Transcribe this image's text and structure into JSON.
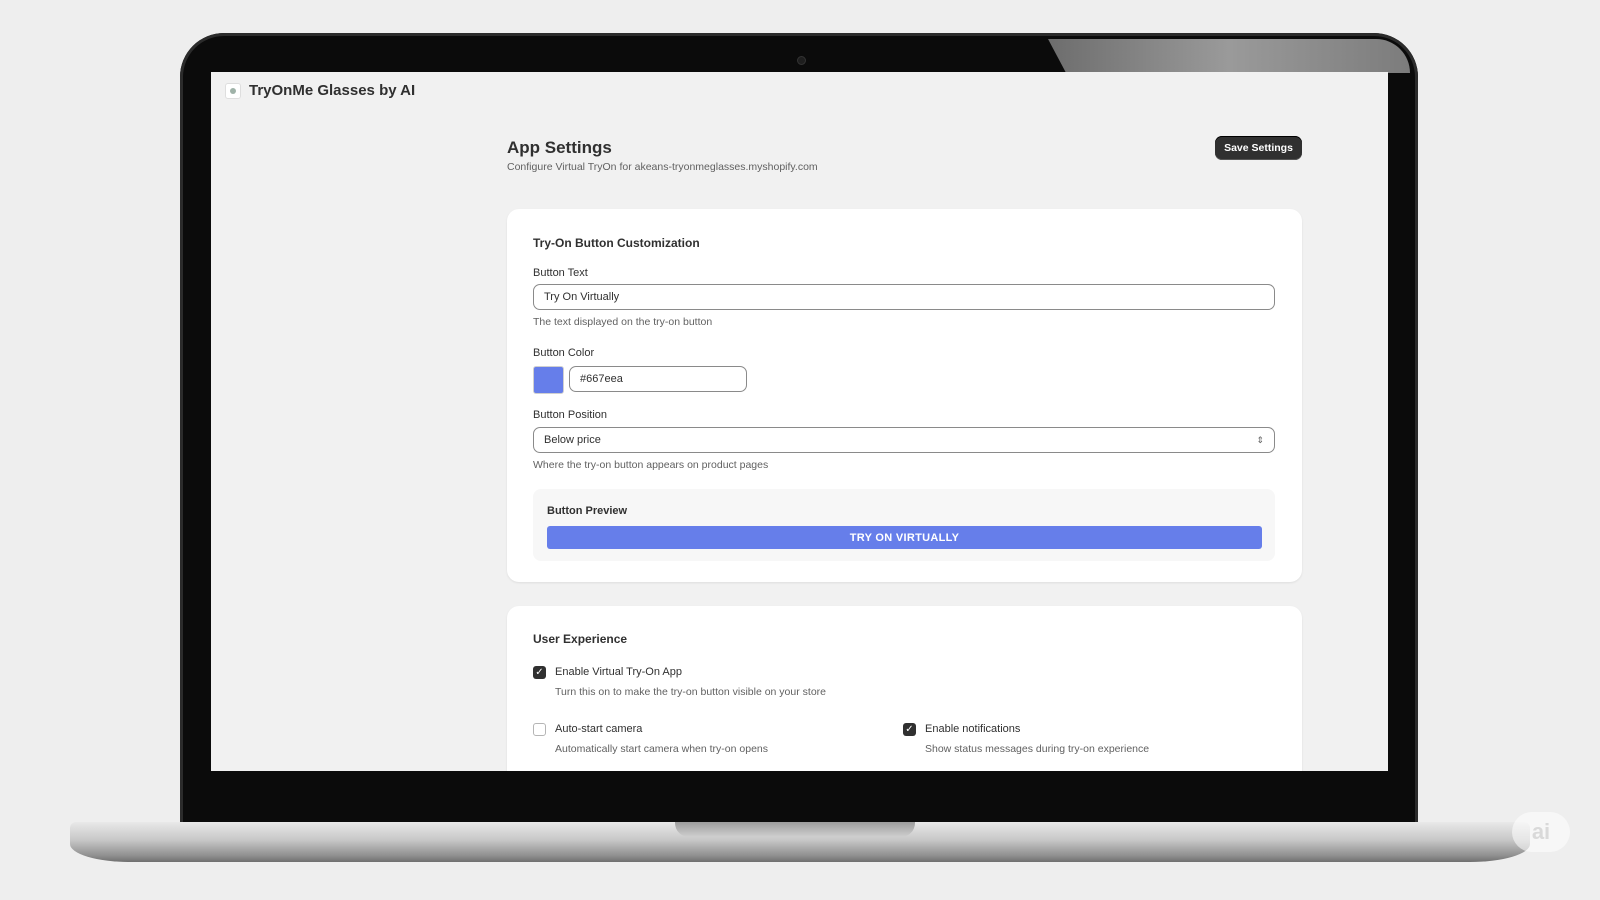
{
  "app": {
    "title": "TryOnMe Glasses by AI"
  },
  "header": {
    "title": "App Settings",
    "subtitle": "Configure Virtual TryOn for akeans-tryonmeglasses.myshopify.com",
    "save_label": "Save Settings"
  },
  "customization": {
    "title": "Try-On Button Customization",
    "button_text": {
      "label": "Button Text",
      "value": "Try On Virtually",
      "help": "The text displayed on the try-on button"
    },
    "button_color": {
      "label": "Button Color",
      "value": "#667eea"
    },
    "button_position": {
      "label": "Button Position",
      "selected": "Below price",
      "help": "Where the try-on button appears on product pages"
    },
    "preview": {
      "label": "Button Preview",
      "button_label": "TRY ON VIRTUALLY"
    }
  },
  "user_experience": {
    "title": "User Experience",
    "options": [
      {
        "label": "Enable Virtual Try-On App",
        "help": "Turn this on to make the try-on button visible on your store",
        "checked": true
      },
      {
        "label": "Auto-start camera",
        "help": "Automatically start camera when try-on opens",
        "checked": false
      },
      {
        "label": "Enable notifications",
        "help": "Show status messages during try-on experience",
        "checked": true
      }
    ]
  },
  "colors": {
    "accent": "#667eea",
    "dark": "#303030",
    "page_bg": "#f1f1f1"
  }
}
